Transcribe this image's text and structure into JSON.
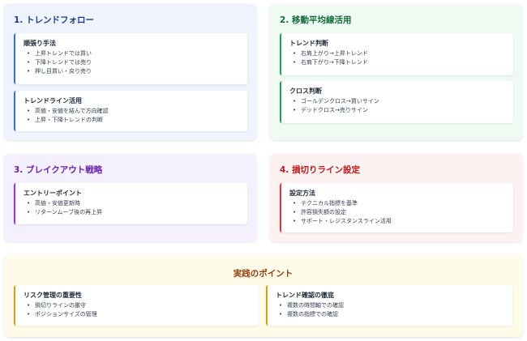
{
  "sections": [
    {
      "title": "1. トレンドフォロー",
      "cards": [
        {
          "title": "順張り手法",
          "items": [
            "上昇トレンドでは買い",
            "下降トレンドでは売り",
            "押し目買い・戻り売り"
          ]
        },
        {
          "title": "トレンドライン活用",
          "items": [
            "高値・安値を結んで方向確認",
            "上昇・下降トレンドの判断"
          ]
        }
      ]
    },
    {
      "title": "2. 移動平均線活用",
      "cards": [
        {
          "title": "トレンド判断",
          "items": [
            "右肩上がり→上昇トレンド",
            "右肩下がり→下降トレンド"
          ]
        },
        {
          "title": "クロス判断",
          "items": [
            "ゴールデンクロス→買いサイン",
            "デッドクロス→売りサイン"
          ]
        }
      ]
    },
    {
      "title": "3. ブレイクアウト戦略",
      "cards": [
        {
          "title": "エントリーポイント",
          "items": [
            "高値・安値更新時",
            "リターンムーブ後の再上昇"
          ]
        }
      ]
    },
    {
      "title": "4. 損切りライン設定",
      "cards": [
        {
          "title": "設定方法",
          "items": [
            "テクニカル指標を基準",
            "許容損失額の設定",
            "サポート・レジスタンスライン活用"
          ]
        }
      ]
    }
  ],
  "practice": {
    "title": "実践のポイント",
    "cards": [
      {
        "title": "リスク管理の重要性",
        "items": [
          "損切りラインの厳守",
          "ポジションサイズの管理"
        ]
      },
      {
        "title": "トレンド確認の徹底",
        "items": [
          "複数の時間軸での確認",
          "複数の指標での確認"
        ]
      }
    ]
  },
  "colors": {
    "section1_accent": "#3b6fd6",
    "section2_accent": "#22a05a",
    "section3_accent": "#9333ea",
    "section4_accent": "#dc3a3a",
    "practice_accent": "#d4a017"
  }
}
